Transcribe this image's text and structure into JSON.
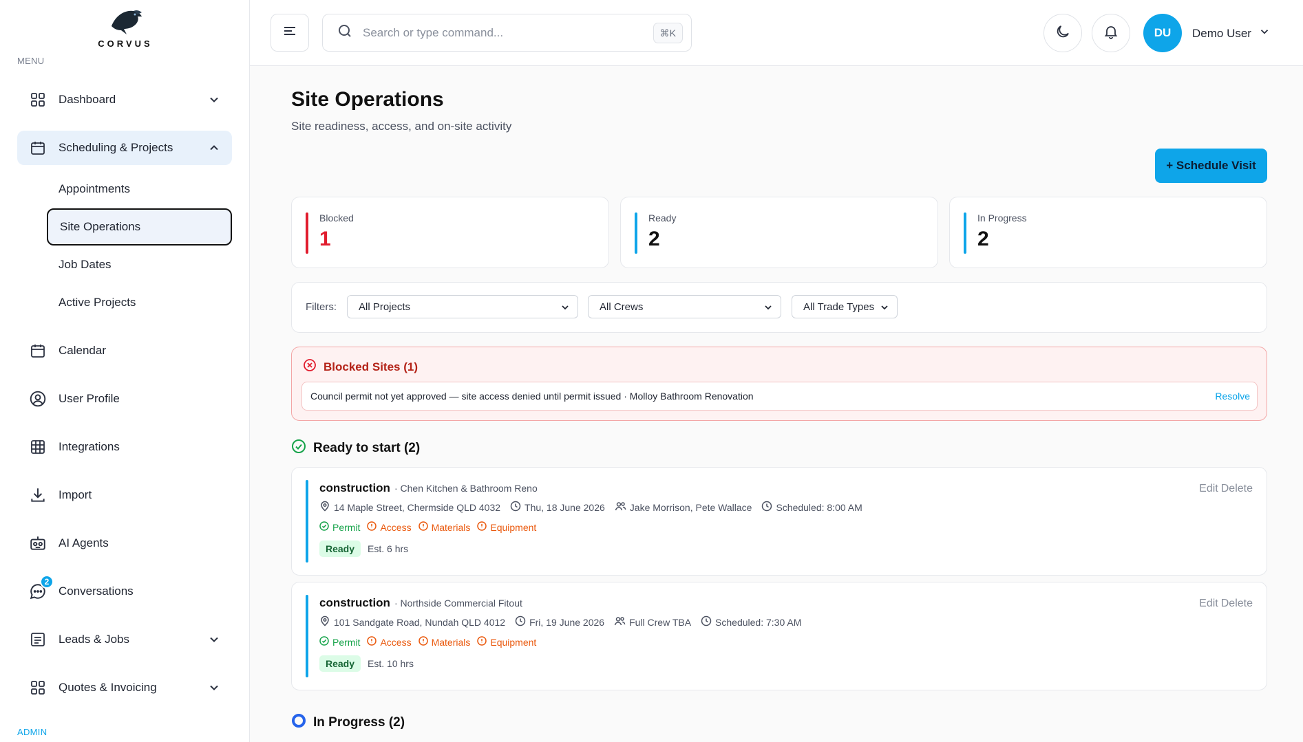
{
  "brand": {
    "logo_text": "CORVUS"
  },
  "sidebar": {
    "menu_caption": "MENU",
    "admin_caption": "ADMIN",
    "items": [
      {
        "label": "Dashboard",
        "icon": "grid-icon"
      },
      {
        "label": "Scheduling & Projects",
        "icon": "calendar-icon"
      },
      {
        "label": "Calendar",
        "icon": "calendar-icon"
      },
      {
        "label": "User Profile",
        "icon": "user-circle-icon"
      },
      {
        "label": "Integrations",
        "icon": "table-icon"
      },
      {
        "label": "Import",
        "icon": "download-icon"
      },
      {
        "label": "AI Agents",
        "icon": "robot-icon"
      },
      {
        "label": "Conversations",
        "icon": "chat-icon",
        "badge": "2"
      },
      {
        "label": "Leads & Jobs",
        "icon": "list-icon"
      },
      {
        "label": "Quotes & Invoicing",
        "icon": "grid-icon"
      }
    ],
    "subitems": [
      "Appointments",
      "Site Operations",
      "Job Dates",
      "Active Projects"
    ]
  },
  "topbar": {
    "search_placeholder": "Search or type command...",
    "shortcut": "⌘K",
    "avatar_initials": "DU",
    "user_name": "Demo User"
  },
  "page": {
    "title": "Site Operations",
    "subtitle": "Site readiness, access, and on-site activity",
    "primary_button": "+ Schedule Visit"
  },
  "stats": [
    {
      "label": "Blocked",
      "value": "1",
      "color": "#e11d2e"
    },
    {
      "label": "Ready",
      "value": "2",
      "color": "#0ea5e9"
    },
    {
      "label": "In Progress",
      "value": "2",
      "color": "#0ea5e9"
    }
  ],
  "filters": {
    "label": "Filters:",
    "projects": "All Projects",
    "crews": "All Crews",
    "trades": "All Trade Types"
  },
  "blocked": {
    "title": "Blocked Sites (1)",
    "row_text": "Council permit not yet approved — site access denied until permit issued · Molloy Bathroom Renovation",
    "action": "Resolve"
  },
  "ready_section": {
    "title": "Ready to start (2)"
  },
  "jobs": [
    {
      "type": "construction",
      "project": "· Chen Kitchen & Bathroom Reno",
      "address": "14 Maple Street, Chermside QLD 4032",
      "date": "Thu, 18 June 2026",
      "crew": "Jake Morrison, Pete Wallace",
      "scheduled": "Scheduled: 8:00 AM",
      "checks": {
        "permit": "Permit",
        "access": "Access",
        "materials": "Materials",
        "equipment": "Equipment"
      },
      "status": "Ready",
      "estimate": "Est. 6 hrs",
      "edit": "Edit",
      "delete": "Delete"
    },
    {
      "type": "construction",
      "project": "· Northside Commercial Fitout",
      "address": "101 Sandgate Road, Nundah QLD 4012",
      "date": "Fri, 19 June 2026",
      "crew": "Full Crew TBA",
      "scheduled": "Scheduled: 7:30 AM",
      "checks": {
        "permit": "Permit",
        "access": "Access",
        "materials": "Materials",
        "equipment": "Equipment"
      },
      "status": "Ready",
      "estimate": "Est. 10 hrs",
      "edit": "Edit",
      "delete": "Delete"
    }
  ],
  "progress_section": {
    "title": "In Progress (2)"
  }
}
